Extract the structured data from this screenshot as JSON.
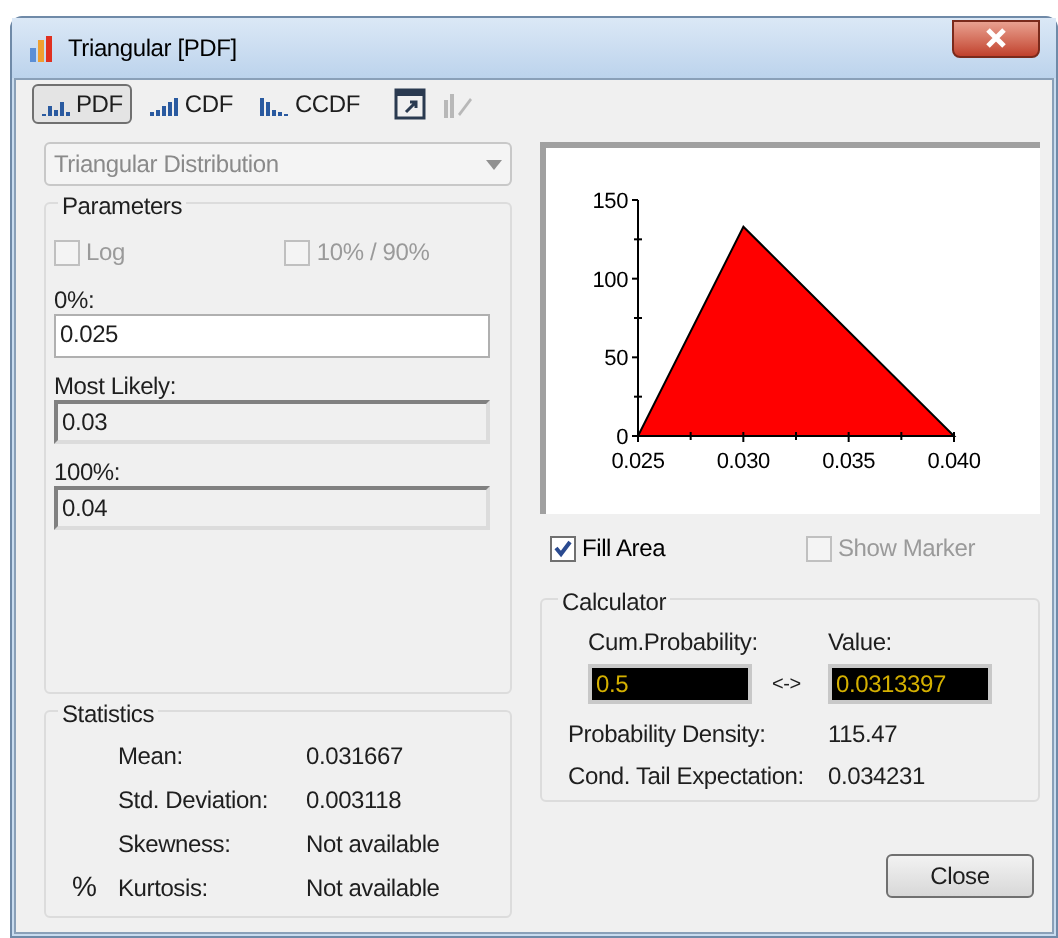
{
  "window": {
    "title": "Triangular [PDF]"
  },
  "tabs": [
    {
      "label": "PDF",
      "selected": true
    },
    {
      "label": "CDF",
      "selected": false
    },
    {
      "label": "CCDF",
      "selected": false
    }
  ],
  "toolbar_buttons": [
    {
      "kind": "export",
      "disabled": false
    },
    {
      "kind": "edit",
      "disabled": true
    }
  ],
  "distribution": {
    "value": "Triangular Distribution",
    "disabled": true
  },
  "parameters": {
    "title": "Parameters",
    "options": [
      {
        "label": "Log",
        "checked": false,
        "disabled": true
      },
      {
        "label": "10% / 90%",
        "checked": false,
        "disabled": true
      }
    ],
    "fields": [
      {
        "label": "0%:",
        "value": "0.025",
        "editable": true
      },
      {
        "label": "Most Likely:",
        "value": "0.03",
        "editable": false
      },
      {
        "label": "100%:",
        "value": "0.04",
        "editable": false
      }
    ]
  },
  "statistics": {
    "title": "Statistics",
    "percent_symbol": "%",
    "rows": [
      {
        "label": "Mean:",
        "value": "0.031667"
      },
      {
        "label": "Std. Deviation:",
        "value": "0.003118"
      },
      {
        "label": "Skewness:",
        "value": "Not available"
      },
      {
        "label": "Kurtosis:",
        "value": "Not available"
      }
    ]
  },
  "chart": {
    "chart_data": {
      "type": "area",
      "x": [
        0.025,
        0.03,
        0.04
      ],
      "series": [
        {
          "color": "#ff0000",
          "values": [
            0,
            133,
            0
          ]
        }
      ],
      "xlim": [
        0.025,
        0.04
      ],
      "ylim": [
        0,
        150
      ],
      "xticks": [
        {
          "value": 0.025,
          "label": "0.025"
        },
        {
          "value": 0.03,
          "label": "0.030"
        },
        {
          "value": 0.035,
          "label": "0.035"
        },
        {
          "value": 0.04,
          "label": "0.040"
        }
      ],
      "yticks": [
        0,
        50,
        100,
        150
      ]
    }
  },
  "display_options": [
    {
      "label": "Fill Area",
      "checked": true,
      "disabled": false
    },
    {
      "label": "Show Marker",
      "checked": false,
      "disabled": true
    }
  ],
  "calculator": {
    "title": "Calculator",
    "cum_probability_label": "Cum.Probability:",
    "cum_probability": "0.5",
    "swap_symbol": "<->",
    "value_label": "Value:",
    "value": "0.0313397",
    "results": [
      {
        "label": "Probability Density:",
        "value": "115.47"
      },
      {
        "label": "Cond. Tail Expectation:",
        "value": "0.034231"
      }
    ]
  },
  "buttons": [
    {
      "label": "Close"
    }
  ]
}
